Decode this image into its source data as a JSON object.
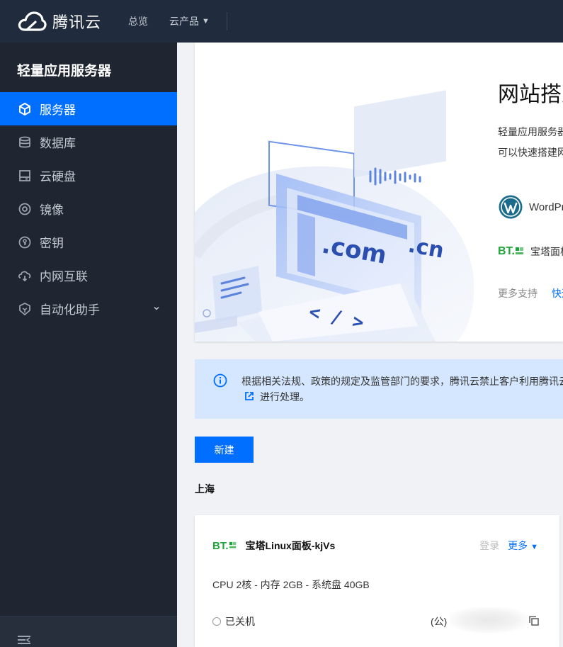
{
  "brand": {
    "name": "腾讯云"
  },
  "nav": {
    "overview": "总览",
    "products": "云产品"
  },
  "sidebar": {
    "title": "轻量应用服务器",
    "items": [
      {
        "label": "服务器",
        "icon": "cube-icon",
        "active": true
      },
      {
        "label": "数据库",
        "icon": "database-icon"
      },
      {
        "label": "云硬盘",
        "icon": "disk-icon"
      },
      {
        "label": "镜像",
        "icon": "image-icon"
      },
      {
        "label": "密钥",
        "icon": "key-icon"
      },
      {
        "label": "内网互联",
        "icon": "network-icon"
      },
      {
        "label": "自动化助手",
        "icon": "automation-icon"
      }
    ]
  },
  "banner": {
    "illustration_text": [
      ".com",
      ".cn",
      "< / >"
    ],
    "title": "网站搭建",
    "description": "轻量应用服务器的应用镜像，您可以快速搭建网站。",
    "wordpress_label": "WordPress",
    "bt_logo": "BT.",
    "bt_label": "宝塔面板",
    "more_label": "更多支持",
    "more_link": "快速"
  },
  "notice": {
    "text_line1": "根据相关法规、政策的规定及监管部门的要求，腾讯云禁止客户利用腾讯云",
    "text_line2": "进行处理。"
  },
  "actions": {
    "new_button": "新建"
  },
  "region": "上海",
  "instance": {
    "name": "宝塔Linux面板-kjVs",
    "logo": "BT.",
    "login": "登录",
    "more": "更多",
    "spec": "CPU 2核 - 内存 2GB - 系统盘 40GB",
    "status": "已关机",
    "ip_prefix": "(公)"
  },
  "colors": {
    "topbar": "#202c3d",
    "sidebar": "#1f2531",
    "accent": "#006eff",
    "notice_bg": "#d5e7ff",
    "bt_green": "#20a53a"
  }
}
